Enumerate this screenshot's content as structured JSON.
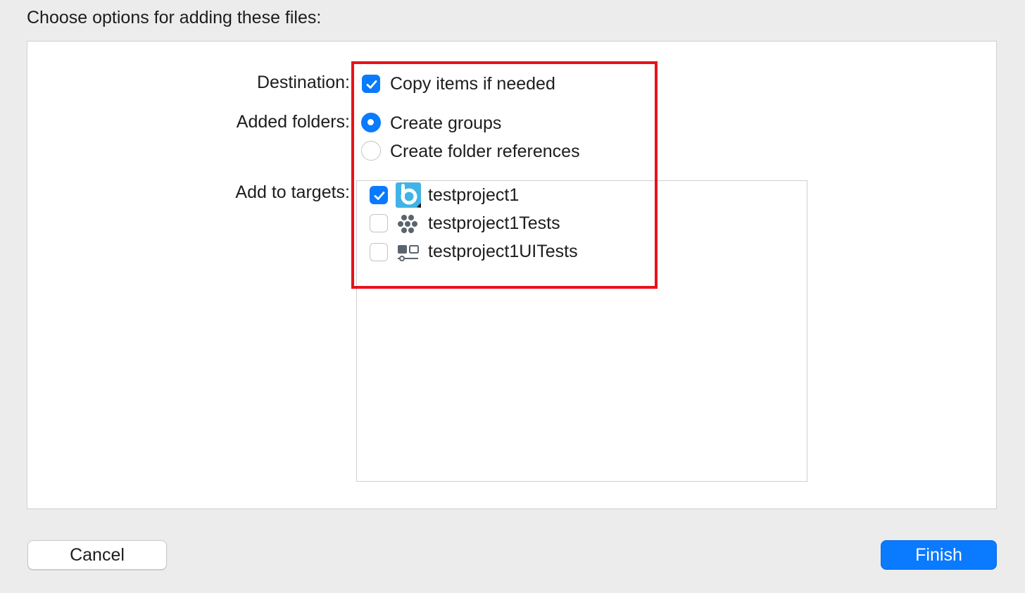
{
  "heading": "Choose options for adding these files:",
  "destination": {
    "label": "Destination:",
    "option_label": "Copy items if needed",
    "checked": true
  },
  "added_folders": {
    "label": "Added folders:",
    "options": [
      {
        "label": "Create groups",
        "selected": true
      },
      {
        "label": "Create folder references",
        "selected": false
      }
    ]
  },
  "targets": {
    "label": "Add to targets:",
    "items": [
      {
        "name": "testproject1",
        "checked": true,
        "icon": "app-target-icon"
      },
      {
        "name": "testproject1Tests",
        "checked": false,
        "icon": "unit-test-target-icon"
      },
      {
        "name": "testproject1UITests",
        "checked": false,
        "icon": "ui-test-target-icon"
      }
    ]
  },
  "buttons": {
    "cancel": "Cancel",
    "finish": "Finish"
  },
  "colors": {
    "accent": "#0a7aff",
    "highlight": "#e8121b"
  }
}
